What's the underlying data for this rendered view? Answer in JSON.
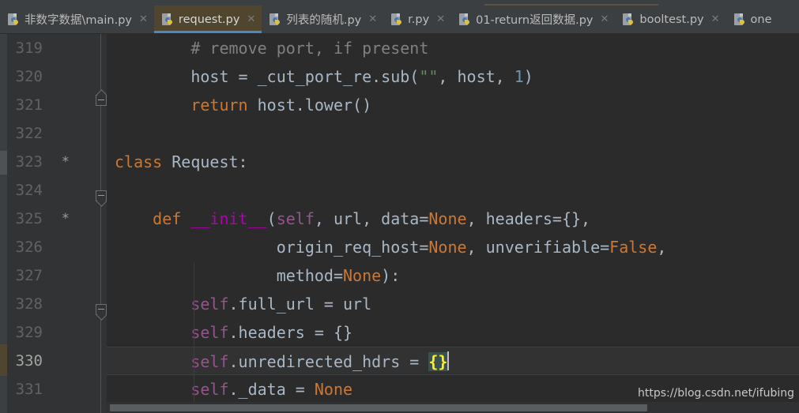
{
  "window": {
    "app": "PyCharm Editor",
    "active_file": "request.py"
  },
  "tabs": [
    {
      "label": "非数字数据\\main.py",
      "icon": "python-file-icon",
      "close": "✕",
      "active": false
    },
    {
      "label": "request.py",
      "icon": "python-file-icon",
      "close": "✕",
      "active": true
    },
    {
      "label": "列表的随机.py",
      "icon": "python-file-icon",
      "close": "✕",
      "active": false
    },
    {
      "label": "r.py",
      "icon": "python-file-icon",
      "close": "✕",
      "active": false
    },
    {
      "label": "01-return返回数据.py",
      "icon": "python-file-icon",
      "close": "✕",
      "active": false
    },
    {
      "label": "booltest.py",
      "icon": "python-file-icon",
      "close": "✕",
      "active": false
    },
    {
      "label": "one",
      "icon": "python-file-icon",
      "close": "✕",
      "active": false
    }
  ],
  "editor": {
    "current_line": 330,
    "lines": [
      {
        "num": "319",
        "marker": "",
        "current": false
      },
      {
        "num": "320",
        "marker": "",
        "current": false
      },
      {
        "num": "321",
        "marker": "",
        "current": false
      },
      {
        "num": "322",
        "marker": "",
        "current": false
      },
      {
        "num": "323",
        "marker": "*",
        "current": false
      },
      {
        "num": "324",
        "marker": "",
        "current": false
      },
      {
        "num": "325",
        "marker": "*",
        "current": false
      },
      {
        "num": "326",
        "marker": "",
        "current": false
      },
      {
        "num": "327",
        "marker": "",
        "current": false
      },
      {
        "num": "328",
        "marker": "",
        "current": false
      },
      {
        "num": "329",
        "marker": "",
        "current": false
      },
      {
        "num": "330",
        "marker": "",
        "current": true
      },
      {
        "num": "331",
        "marker": "",
        "current": false
      }
    ],
    "code": {
      "l319": "        # remove port, if present",
      "l320_a": "        host = _cut_port_re.sub(",
      "l320_str": "\"\"",
      "l320_b": ", host, ",
      "l320_num": "1",
      "l320_c": ")",
      "l321_kw": "return",
      "l321_rest": " host.lower()",
      "l322": "",
      "l323_kw": "class",
      "l323_rest": " Request:",
      "l324": "",
      "l325_indent": "    ",
      "l325_def": "def",
      "l325_name": " __init__",
      "l325_p1": "(",
      "l325_self": "self",
      "l325_p2": ", url, data=",
      "l325_none": "None",
      "l325_p3": ", headers={},",
      "l326_indent": "                 ",
      "l326_a": "origin_req_host=",
      "l326_none1": "None",
      "l326_b": ", unverifiable=",
      "l326_false": "False",
      "l326_c": ",",
      "l327_indent": "                 ",
      "l327_a": "method=",
      "l327_none": "None",
      "l327_b": "):",
      "l328_self": "self",
      "l328_rest": ".full_url = url",
      "l329_self": "self",
      "l329_rest": ".headers = {}",
      "l330_self": "self",
      "l330_mid": ".unredirected_hdrs = ",
      "l330_brace": "{}",
      "l331_self": "self",
      "l331_mid": "._data = ",
      "l331_none": "None"
    },
    "colors": {
      "background": "#2b2b2b",
      "gutter": "#313335",
      "keyword": "#cc7832",
      "string": "#6a8759",
      "number": "#6897bb",
      "comment": "#808080",
      "self": "#94558d",
      "dunder": "#b200b2",
      "default_text": "#a9b7c6",
      "brace_highlight_bg": "#3b514d",
      "brace_highlight_fg": "#ffef28",
      "tab_active_bg": "#50462f",
      "tab_active_underline": "#4a88c7"
    }
  },
  "watermark": {
    "text": "https://blog.csdn.net/ifubing"
  }
}
